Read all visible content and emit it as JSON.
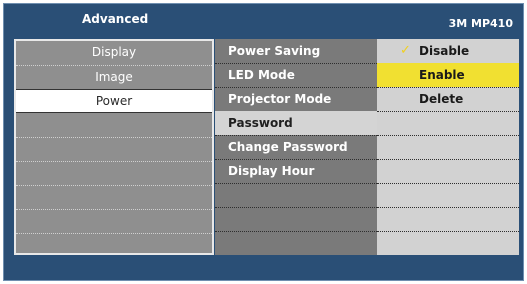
{
  "header": {
    "title": "Advanced",
    "model": "3M MP410"
  },
  "tabs": [
    {
      "label": "Display",
      "selected": false
    },
    {
      "label": "Image",
      "selected": false
    },
    {
      "label": "Power",
      "selected": true
    }
  ],
  "menu_items": [
    {
      "label": "Power Saving",
      "selected": false
    },
    {
      "label": "LED Mode",
      "selected": false
    },
    {
      "label": "Projector Mode",
      "selected": false
    },
    {
      "label": "Password",
      "selected": true
    },
    {
      "label": "Change Password",
      "selected": false
    },
    {
      "label": "Display Hour",
      "selected": false
    }
  ],
  "options": [
    {
      "label": "Disable",
      "checked": true,
      "highlighted": false
    },
    {
      "label": "Enable",
      "checked": false,
      "highlighted": true
    },
    {
      "label": "Delete",
      "checked": false,
      "highlighted": false
    }
  ],
  "icons": {
    "check": "check-icon"
  },
  "colors": {
    "background": "#2a4f76",
    "highlight": "#f1e031",
    "check": "#f0d020"
  }
}
